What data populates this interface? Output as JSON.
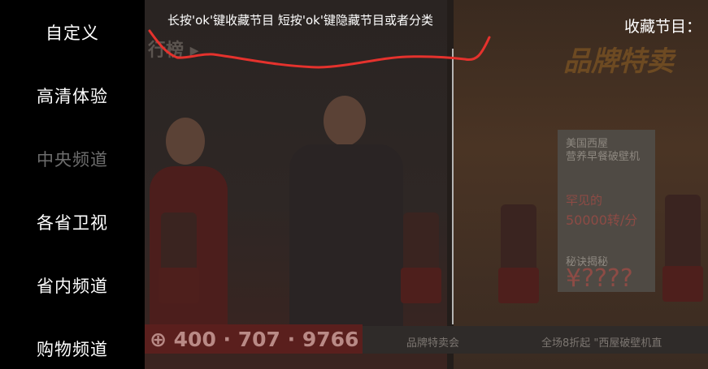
{
  "sidebar": {
    "items": [
      {
        "label": "自定义",
        "state": "normal"
      },
      {
        "label": "高清体验",
        "state": "normal"
      },
      {
        "label": "中央频道",
        "state": "dimmed"
      },
      {
        "label": "各省卫视",
        "state": "normal"
      },
      {
        "label": "省内频道",
        "state": "normal"
      },
      {
        "label": "购物频道",
        "state": "normal"
      }
    ]
  },
  "overlay": {
    "hint": "长按'ok'键收藏节目 短按'ok'键隐藏节目或者分类",
    "favorites_label": "收藏节目："
  },
  "video": {
    "rank_text": "行榜 ▸",
    "brand_text": "品牌特卖",
    "phone": "⊕ 400 · 707 · 9766",
    "strip_left": "品牌特卖会",
    "strip_right": "全场8折起 \"西屋破壁机直",
    "card": {
      "line1": "美国西屋",
      "line2": "营养早餐破壁机",
      "line3": "罕见的",
      "line4": "50000转/分",
      "line5": "秘诀揭秘",
      "price": "¥????"
    }
  },
  "colors": {
    "background": "#000000",
    "menu_text": "#ffffff",
    "menu_text_dim": "#6d6d6d",
    "annotation_stroke": "#e5322d"
  }
}
